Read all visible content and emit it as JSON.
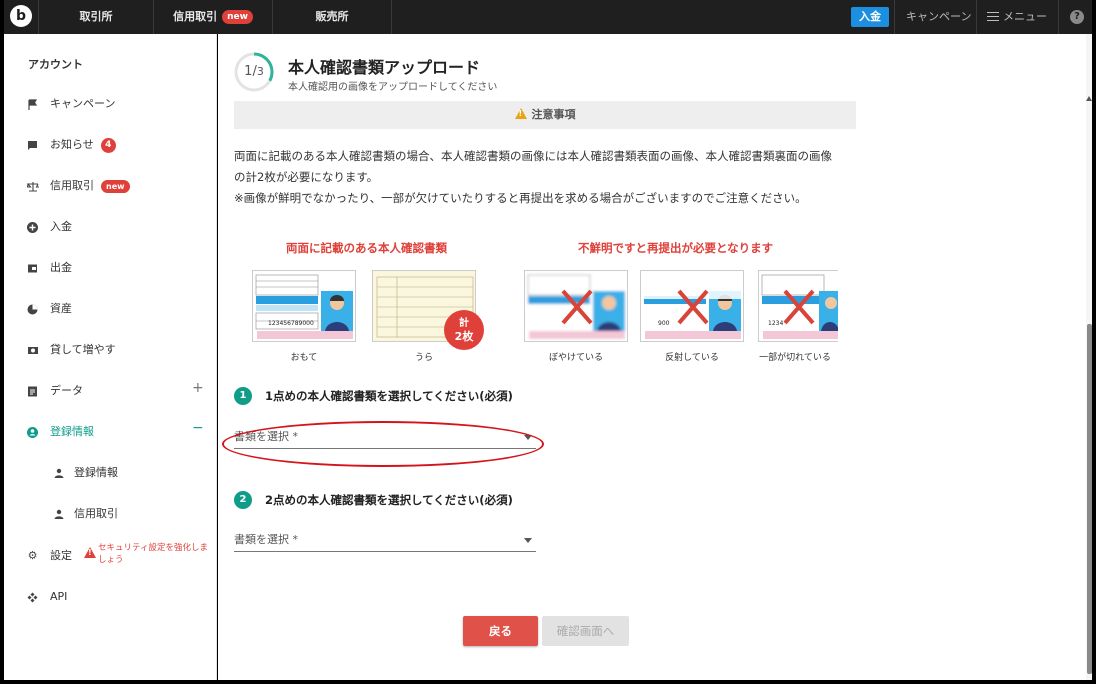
{
  "colors": {
    "accent": "#0f9d8a",
    "danger": "#e0403a",
    "topbar": "#1f1f1f",
    "deposit": "#1d8fe0"
  },
  "topbar": {
    "logo": "b",
    "tabs": [
      {
        "label": "取引所",
        "badge": ""
      },
      {
        "label": "信用取引",
        "badge": "new"
      },
      {
        "label": "販売所",
        "badge": ""
      }
    ],
    "deposit_label": "入金",
    "campaign_label": "キャンペーン",
    "menu_label": "メニュー",
    "help_icon": "help-icon",
    "help_glyph": "?"
  },
  "sidebar": {
    "heading": "アカウント",
    "items": [
      {
        "label": "キャンペーン",
        "icon": "flag-icon"
      },
      {
        "label": "お知らせ",
        "icon": "message-icon",
        "count": "4"
      },
      {
        "label": "信用取引",
        "icon": "scale-icon",
        "badge": "new"
      },
      {
        "label": "入金",
        "icon": "plus-circle-icon"
      },
      {
        "label": "出金",
        "icon": "wallet-icon"
      },
      {
        "label": "資産",
        "icon": "pie-chart-icon"
      },
      {
        "label": "貸して増やす",
        "icon": "lend-icon"
      },
      {
        "label": "データ",
        "icon": "clipboard-icon",
        "expander": "+"
      },
      {
        "label": "登録情報",
        "icon": "user-circle-icon",
        "expander": "−"
      },
      {
        "label": "設定",
        "icon": "gear-icon"
      },
      {
        "label": "API",
        "icon": "api-icon"
      }
    ],
    "sub_items": [
      {
        "label": "登録情報",
        "icon": "person-icon"
      },
      {
        "label": "信用取引",
        "icon": "person-icon"
      }
    ],
    "settings_warning": "セキュリティ設定を強化しましょう"
  },
  "main": {
    "step": {
      "current": "1",
      "total": "3",
      "progress": 0.33
    },
    "title": "本人確認書類アップロード",
    "subtitle": "本人確認用の画像をアップロードしてください",
    "notice_label": "注意事項",
    "body_line1": "両面に記載のある本人確認書類の場合、本人確認書類の画像には本人確認書類表面の画像、本人確認書類裏面の画像",
    "body_line2": "の計2枚が必要になります。",
    "body_line3": "※画像が鮮明でなかったり、一部が欠けていたりすると再提出を求める場合がございますのでご注意ください。",
    "examples_heading_left": "両面に記載のある本人確認書類",
    "examples_heading_right": "不鮮明ですと再提出が必要となります",
    "count_circle_line1": "計",
    "count_circle_line2": "2枚",
    "cards": [
      {
        "caption": "おもて",
        "card_number": "123456789000"
      },
      {
        "caption": "うら",
        "card_number": ""
      },
      {
        "caption": "ぼやけている",
        "card_number": ""
      },
      {
        "caption": "反射している",
        "card_number": "900"
      },
      {
        "caption": "一部が切れている",
        "card_number": "1234"
      }
    ],
    "requirement1": {
      "num": "1",
      "label": "1点めの本人確認書類を選択してください(必須)",
      "placeholder": "書類を選択 *"
    },
    "requirement2": {
      "num": "2",
      "label": "2点めの本人確認書類を選択してください(必須)",
      "placeholder": "書類を選択 *"
    },
    "back_label": "戻る",
    "confirm_label": "確認画面へ"
  }
}
